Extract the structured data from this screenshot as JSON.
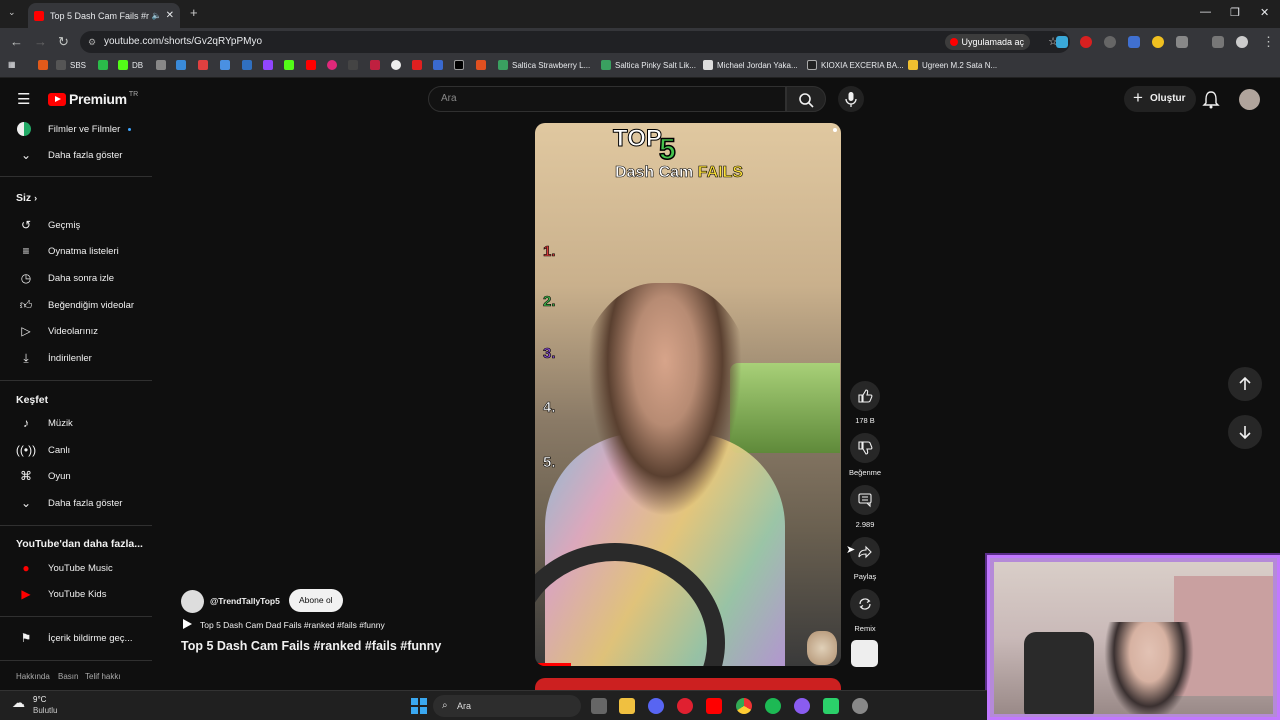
{
  "browser": {
    "tab_title": "Top 5 Dash Cam Fails #ranke",
    "url": "youtube.com/shorts/Gv2qRYpPMyo",
    "open_in_app": "Uygulamada aç",
    "bookmarks": [
      "SBS",
      "DB",
      "Saltica Strawberry L...",
      "Saltica Pinky Salt Lik...",
      "Michael Jordan Yaka...",
      "KIOXIA EXCERIA BA...",
      "Ugreen M.2 Sata N..."
    ]
  },
  "masthead": {
    "logo_text": "Premium",
    "logo_region": "TR",
    "search_placeholder": "Ara",
    "create_label": "Oluştur"
  },
  "sidebar": {
    "top_items": [
      {
        "label": "Filmler ve Filmler",
        "icon": "film-icon"
      },
      {
        "label": "Daha fazla göster",
        "icon": "chevron-down-icon"
      }
    ],
    "you_header": "Siz",
    "you_items": [
      {
        "label": "Geçmiş",
        "icon": "history-icon"
      },
      {
        "label": "Oynatma listeleri",
        "icon": "playlist-icon"
      },
      {
        "label": "Daha sonra izle",
        "icon": "clock-icon"
      },
      {
        "label": "Beğendiğim videolar",
        "icon": "thumbs-up-icon"
      },
      {
        "label": "Videolarınız",
        "icon": "video-icon"
      },
      {
        "label": "İndirilenler",
        "icon": "download-icon"
      }
    ],
    "explore_header": "Keşfet",
    "explore_items": [
      {
        "label": "Müzik",
        "icon": "music-icon"
      },
      {
        "label": "Canlı",
        "icon": "live-icon"
      },
      {
        "label": "Oyun",
        "icon": "gamepad-icon"
      },
      {
        "label": "Daha fazla göster",
        "icon": "chevron-down-icon"
      }
    ],
    "more_header": "YouTube'dan daha fazla...",
    "more_items": [
      {
        "label": "YouTube Music",
        "icon": "youtube-music-icon"
      },
      {
        "label": "YouTube Kids",
        "icon": "youtube-kids-icon"
      }
    ],
    "report_label": "İçerik bildirme geç...",
    "footer_links": [
      "Hakkında",
      "Basın",
      "Telif hakkı"
    ]
  },
  "video": {
    "overlay_top": "TOP",
    "overlay_five": "5",
    "overlay_dash": "Dash Cam",
    "overlay_fails": "FAILS",
    "ranks": [
      "1.",
      "2.",
      "3.",
      "4.",
      "5."
    ],
    "rank_colors": [
      "#d93a3a",
      "#3fb34a",
      "#8b4fd1",
      "#ffffff",
      "#ffffff"
    ]
  },
  "actions": {
    "likes": "178 B",
    "dislike_label": "Beğenme",
    "comments": "2.989",
    "share_label": "Paylaş",
    "remix_label": "Remix"
  },
  "channel": {
    "handle": "@TrendTallyTop5",
    "subscribe_label": "Abone ol",
    "playlist_title": "Top 5 Dash Cam Dad Fails #ranked #fails #funny",
    "title": "Top 5 Dash Cam Fails #ranked #fails #funny"
  },
  "taskbar": {
    "weather_temp": "9°C",
    "weather_desc": "Bulutlu",
    "search_placeholder": "Ara"
  }
}
